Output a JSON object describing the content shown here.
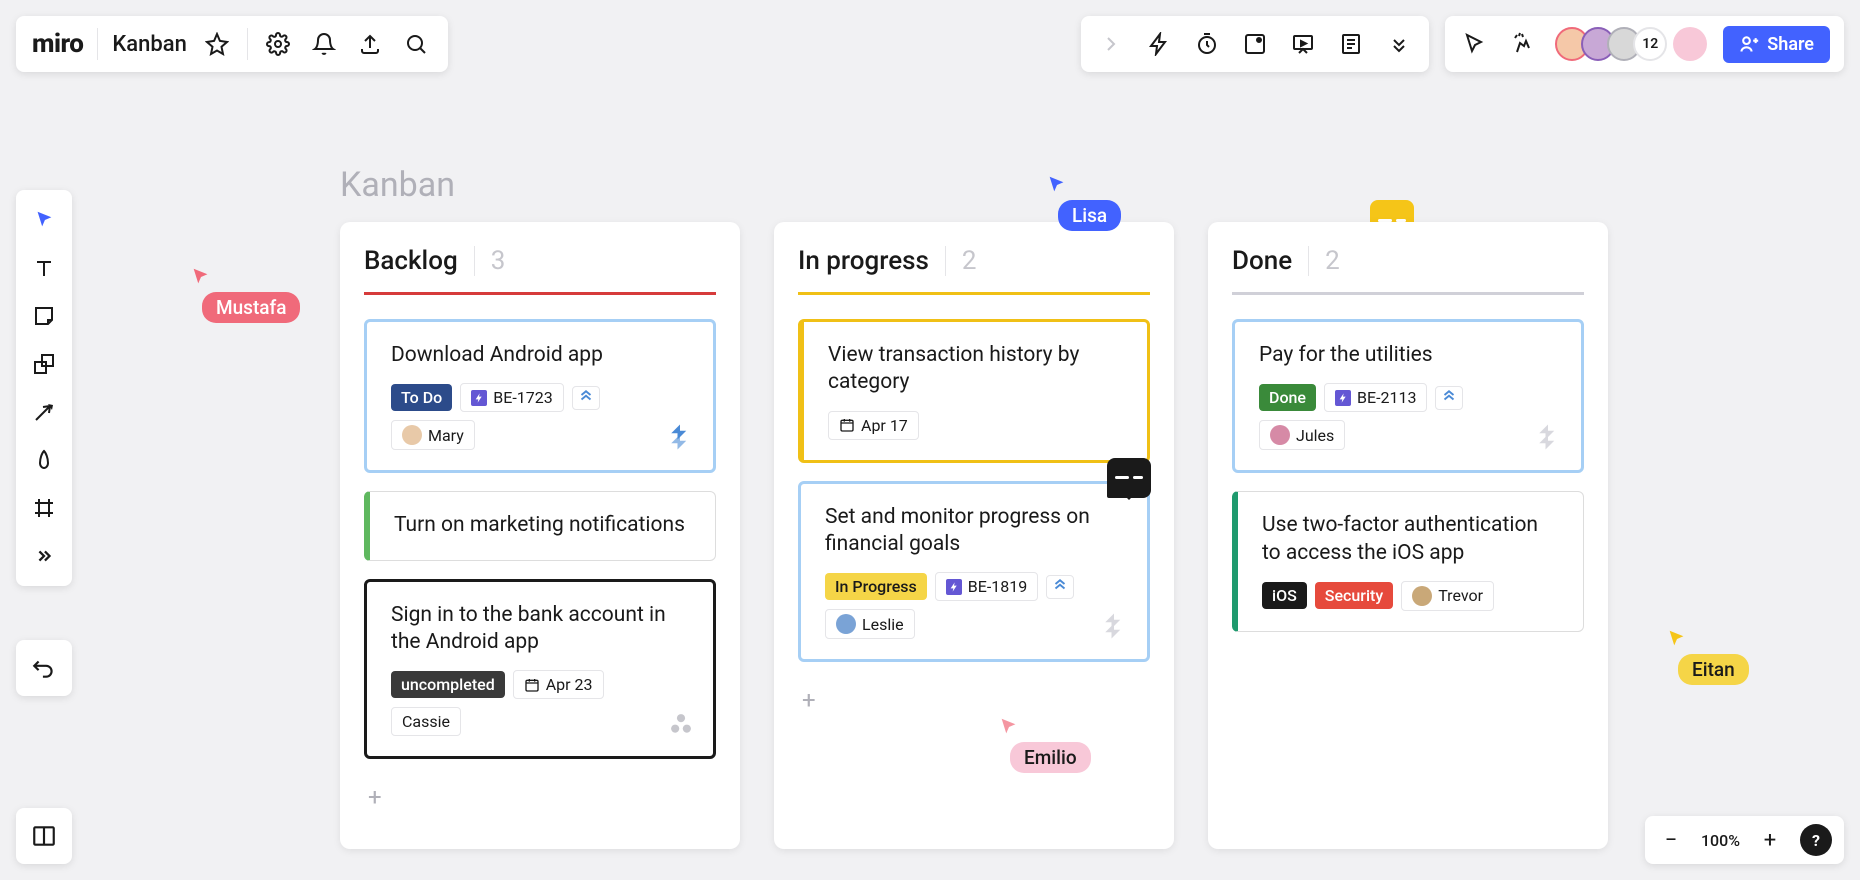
{
  "header": {
    "logo": "miro",
    "board_name": "Kanban"
  },
  "share_label": "Share",
  "collaborator_count": "12",
  "zoom": {
    "level": "100%"
  },
  "board_title": "Kanban",
  "columns": [
    {
      "title": "Backlog",
      "count": "3",
      "accent": "#d63b3b",
      "cards": [
        {
          "title": "Download Android app",
          "border": "3px solid #a6cff5",
          "status": {
            "label": "To Do",
            "bg": "#2c4b8a"
          },
          "ticket": {
            "label": "BE-1723"
          },
          "has_priority": true,
          "assignee": {
            "name": "Mary",
            "color": "#e8c9a8"
          },
          "footer_icon": "jira"
        },
        {
          "title": "Turn on marketing notifications",
          "border": "1px solid #ddd",
          "left_accent": "#5fb85f"
        },
        {
          "title": "Sign in to the bank account in the Android app",
          "border": "3px solid #1a1a1a",
          "status": {
            "label": "uncompleted",
            "bg": "#3a3a3a"
          },
          "date": "Apr 23",
          "plain_tag": "Cassie",
          "footer_icon": "asana"
        }
      ]
    },
    {
      "title": "In progress",
      "count": "2",
      "accent": "#f0c016",
      "cards": [
        {
          "title": "View transaction history by category",
          "border": "3px solid #f0c016",
          "left_accent": "#f0c016",
          "date": "Apr 17"
        },
        {
          "title": "Set and monitor progress on financial goals",
          "border": "3px solid #a6cff5",
          "comment_icon": true,
          "status": {
            "label": "In Progress",
            "bg": "#f5d547",
            "fg": "#1a1a1a"
          },
          "ticket": {
            "label": "BE-1819"
          },
          "has_priority": true,
          "assignee": {
            "name": "Leslie",
            "color": "#7aa3d6"
          },
          "footer_icon": "jira-faded"
        }
      ]
    },
    {
      "title": "Done",
      "count": "2",
      "accent": "#d0d0d8",
      "cards": [
        {
          "title": "Pay for the utilities",
          "border": "3px solid #a6cff5",
          "status": {
            "label": "Done",
            "bg": "#3a8a3a"
          },
          "ticket": {
            "label": "BE-2113"
          },
          "has_priority": true,
          "assignee": {
            "name": "Jules",
            "color": "#d68aa6"
          },
          "footer_icon": "jira-faded"
        },
        {
          "title": "Use two-factor authentication to access the iOS app",
          "border": "1px solid #ddd",
          "left_accent": "#1f9a6e",
          "ios_tag": "iOS",
          "security_tag": "Security",
          "assignee": {
            "name": "Trevor",
            "color": "#c9a878"
          }
        }
      ]
    }
  ],
  "cursors": {
    "mustafa": {
      "name": "Mustafa",
      "color": "#f06a7a"
    },
    "lisa": {
      "name": "Lisa",
      "color": "#4262ff"
    },
    "emilio": {
      "name": "Emilio",
      "bg": "#f8c8d8",
      "fg": "#1a1a1a",
      "cursor_color": "#f06a7a"
    },
    "eitan": {
      "name": "Eitan",
      "bg": "#f5d547",
      "fg": "#1a1a1a",
      "cursor_color": "#f5d547"
    }
  },
  "comment_indicator": {
    "color": "#f5c518"
  }
}
